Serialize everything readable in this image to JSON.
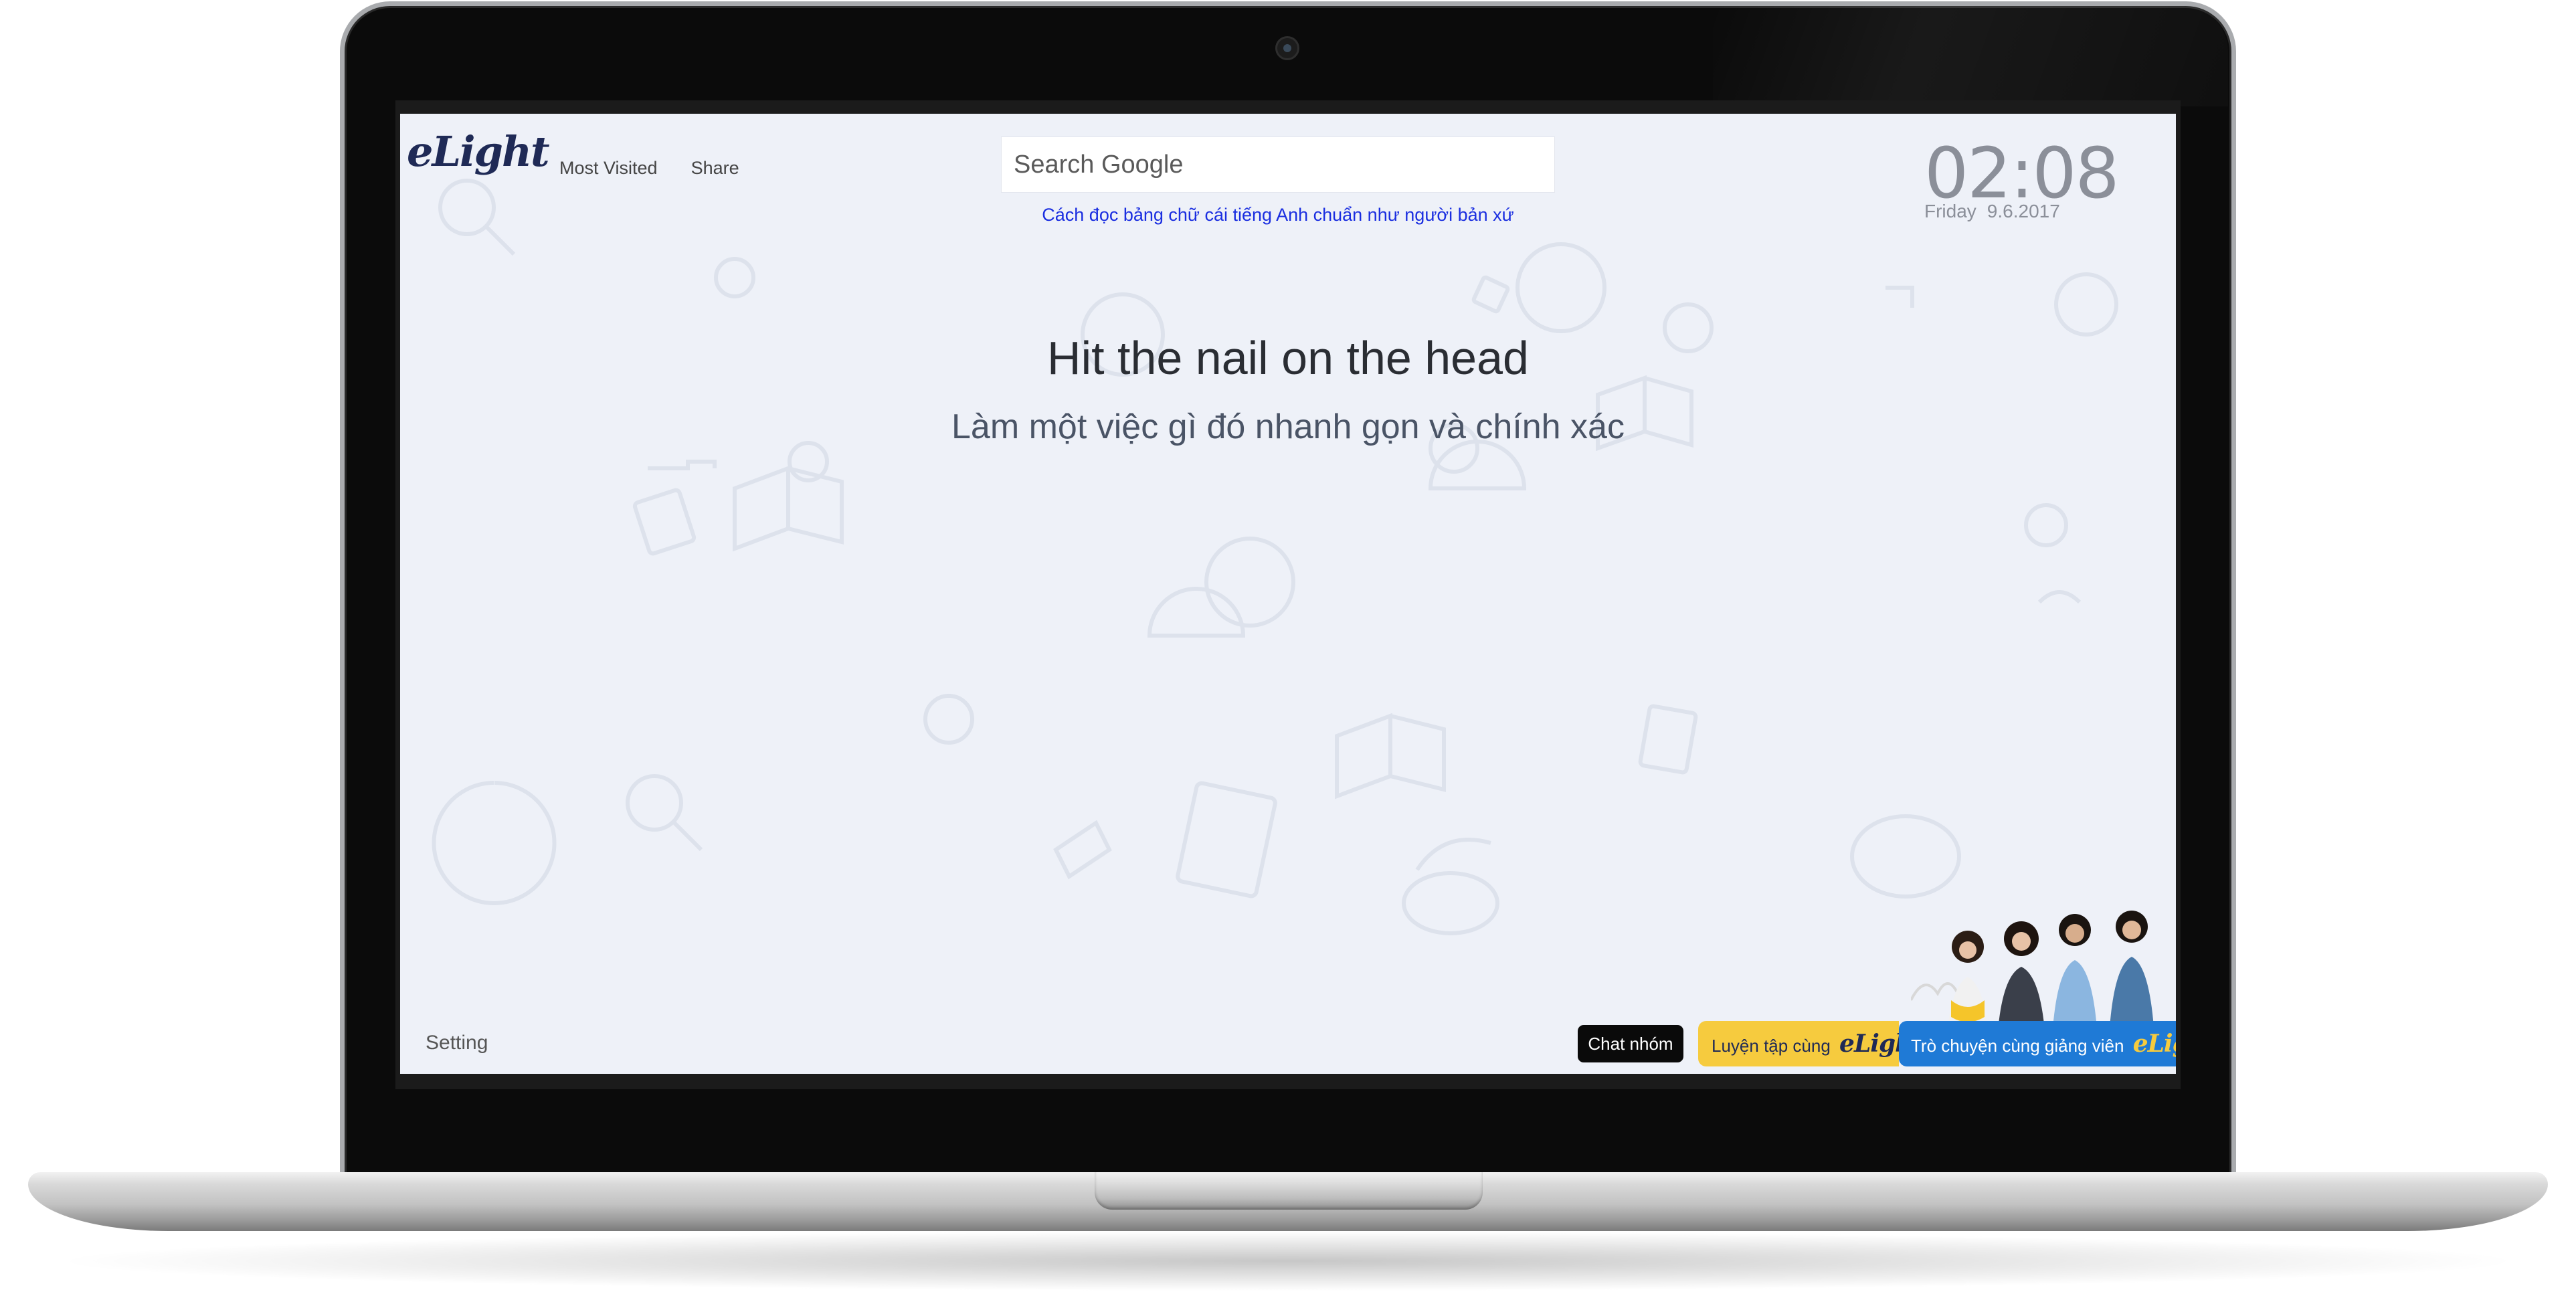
{
  "page": {
    "logo": "eLight",
    "nav": [
      "Most Visited",
      "Share"
    ],
    "search": {
      "placeholder": "Search Google"
    },
    "tip_link": "Cách đọc bảng chữ cái tiếng Anh chuẩn như người bản xứ",
    "clock": {
      "time": "02:08",
      "weekday": "Friday",
      "date": "9.6.2017"
    },
    "idiom": {
      "phrase": "Hit the nail on the head",
      "meaning": "Làm một việc gì đó nhanh gọn và chính xác"
    },
    "setting_label": "Setting",
    "footer_buttons": {
      "chat": "Chat nhóm",
      "practice": "Luyện tập cùng",
      "practice_brand": "eLight",
      "talk": "Trò chuyện cùng giảng viên",
      "talk_brand": "eLight"
    }
  },
  "colors": {
    "page_background": "#eef1f8",
    "brand_navy": "#1f2a56",
    "brand_yellow": "#f6cb3e",
    "brand_blue": "#1f7ad6",
    "link": "#1a2ee0"
  },
  "icons": [
    "webcam-icon",
    "background-doodle-pattern",
    "team-photo"
  ]
}
